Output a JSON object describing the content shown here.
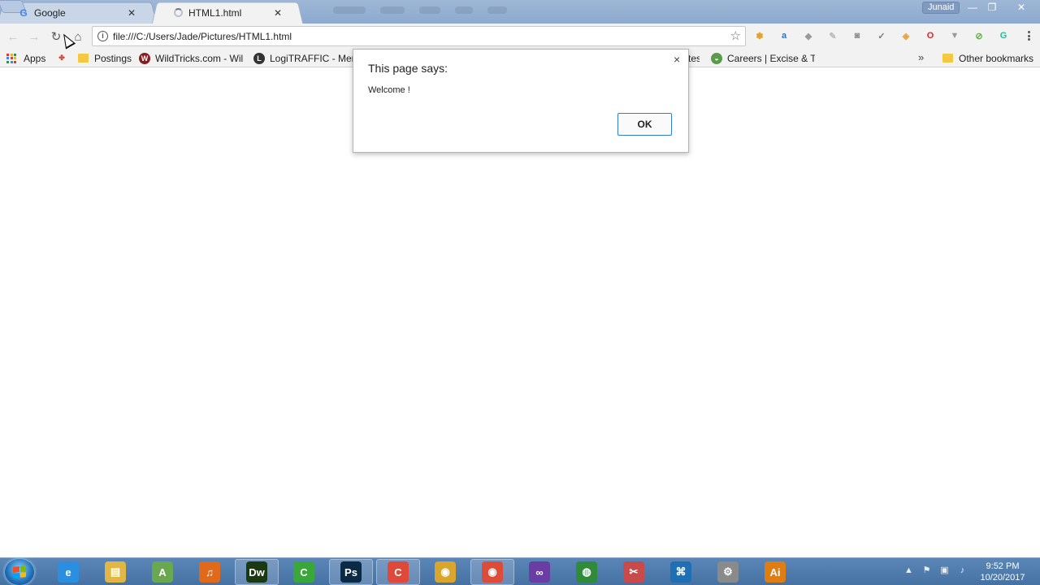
{
  "window": {
    "profile_name": "Junaid",
    "minimize_glyph": "—",
    "maximize_glyph": "❐",
    "close_glyph": "✕"
  },
  "tabs": [
    {
      "title": "Google",
      "favicon_text": "G",
      "close_glyph": "✕"
    },
    {
      "title": "HTML1.html",
      "close_glyph": "✕"
    }
  ],
  "toolbar": {
    "back_glyph": "←",
    "forward_glyph": "→",
    "reload_glyph": "↻",
    "home_glyph": "⌂",
    "info_glyph": "i",
    "url": "file:///C:/Users/Jade/Pictures/HTML1.html",
    "star_glyph": "☆",
    "extensions": [
      {
        "icon": "puzzle-extension-icon",
        "color": "#e4a12a",
        "glyph": "✽"
      },
      {
        "icon": "ab-extension-icon",
        "color": "#2a6fcf",
        "glyph": "a"
      },
      {
        "icon": "diamond-extension-icon",
        "color": "#9a9a9a",
        "glyph": "◆"
      },
      {
        "icon": "eyedropper-extension-icon",
        "color": "#b9b9b9",
        "glyph": "✎"
      },
      {
        "icon": "camera-extension-icon",
        "color": "#8a8a8a",
        "glyph": "◙"
      },
      {
        "icon": "check-extension-icon",
        "color": "#7a7a7a",
        "glyph": "✓"
      },
      {
        "icon": "shield-extension-icon",
        "color": "#e6a23c",
        "glyph": "◈"
      },
      {
        "icon": "opera-extension-icon",
        "color": "#e0262d",
        "glyph": "O"
      },
      {
        "icon": "adblock-extension-icon",
        "color": "#9a9a9a",
        "glyph": "▼"
      },
      {
        "icon": "green-circle-extension-icon",
        "color": "#5cb638",
        "glyph": "⊘"
      },
      {
        "icon": "grammarly-extension-icon",
        "color": "#15c39a",
        "glyph": "G"
      }
    ]
  },
  "bookmarks": {
    "apps_label": "Apps",
    "items": [
      {
        "label": "Postings",
        "icon": "folder"
      },
      {
        "label": "WildTricks.com - Wild",
        "icon": "wildtricks"
      },
      {
        "label": "LogiTRAFFIC - Member",
        "icon": "logitraffic"
      },
      {
        "label": "tes",
        "icon": "none"
      },
      {
        "label": "Careers | Excise & Taxation",
        "icon": "careers"
      }
    ],
    "more_glyph": "»",
    "other_label": "Other bookmarks"
  },
  "dialog": {
    "title": "This page says:",
    "message": "Welcome !",
    "ok_label": "OK",
    "close_glyph": "×"
  },
  "taskbar": {
    "apps": [
      {
        "name": "internet-explorer",
        "label": "e",
        "color": "#2a8fe0"
      },
      {
        "name": "file-explorer",
        "label": "▤",
        "color": "#e0b645"
      },
      {
        "name": "android-studio",
        "label": "A",
        "color": "#6aa84f"
      },
      {
        "name": "audacity",
        "label": "♫",
        "color": "#e06a1a"
      },
      {
        "name": "dreamweaver",
        "label": "Dw",
        "color": "#1b3a12"
      },
      {
        "name": "camtasia",
        "label": "C",
        "color": "#3aa73a"
      },
      {
        "name": "photoshop",
        "label": "Ps",
        "color": "#0a2a45"
      },
      {
        "name": "camtasia-recorder",
        "label": "C",
        "color": "#e0493a"
      },
      {
        "name": "chrome-canary",
        "label": "◉",
        "color": "#d9a52c"
      },
      {
        "name": "chrome",
        "label": "◉",
        "color": "#dd4b39"
      },
      {
        "name": "visual-studio",
        "label": "∞",
        "color": "#6a3da5"
      },
      {
        "name": "globe-app",
        "label": "◍",
        "color": "#2f8a3a"
      },
      {
        "name": "snipping-tool",
        "label": "✂",
        "color": "#c94a4a"
      },
      {
        "name": "vs-code",
        "label": "⌘",
        "color": "#1f6fb5"
      },
      {
        "name": "settings-app",
        "label": "⚙",
        "color": "#8a8a8a"
      },
      {
        "name": "illustrator",
        "label": "Ai",
        "color": "#e07d12"
      }
    ],
    "clock_time": "9:52 PM",
    "clock_date": "10/20/2017"
  }
}
